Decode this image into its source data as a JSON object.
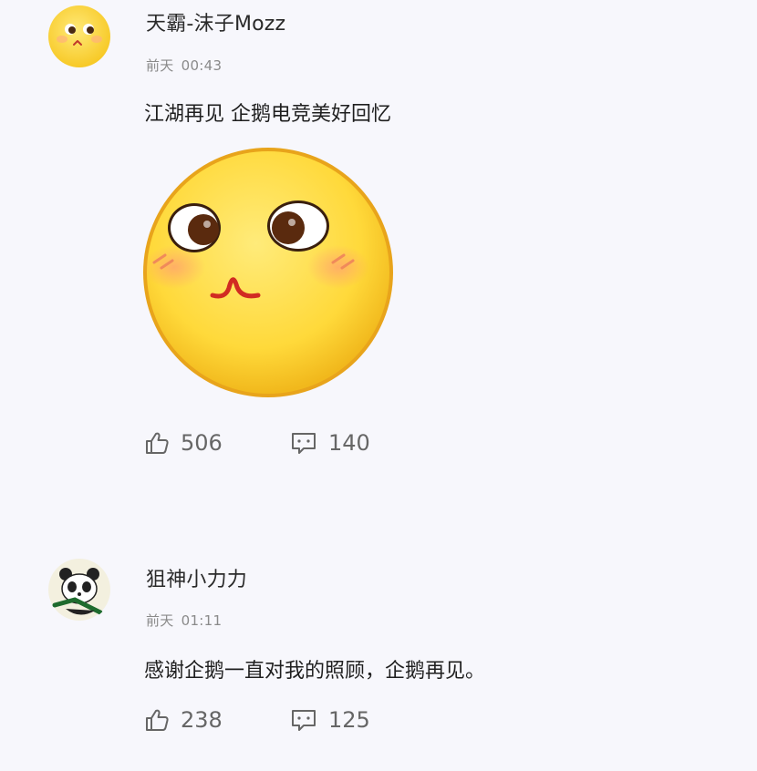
{
  "comments": [
    {
      "username": "天霸-沫子Mozz",
      "day": "前天",
      "time": "00:43",
      "text": "江湖再见 企鹅电竞美好回忆",
      "has_sticker": true,
      "likes": "506",
      "replies": "140"
    },
    {
      "username": "狙神小力力",
      "day": "前天",
      "time": "01:11",
      "text": "感谢企鹅一直对我的照顾，企鹅再见。",
      "has_sticker": false,
      "likes": "238",
      "replies": "125"
    }
  ],
  "icons": {
    "like": "thumbs-up-icon",
    "reply": "comment-bubble-icon"
  },
  "colors": {
    "background": "#f7f7fc",
    "emoji_yellow": "#ffd93a",
    "secondary_text": "#8a8a8a"
  }
}
